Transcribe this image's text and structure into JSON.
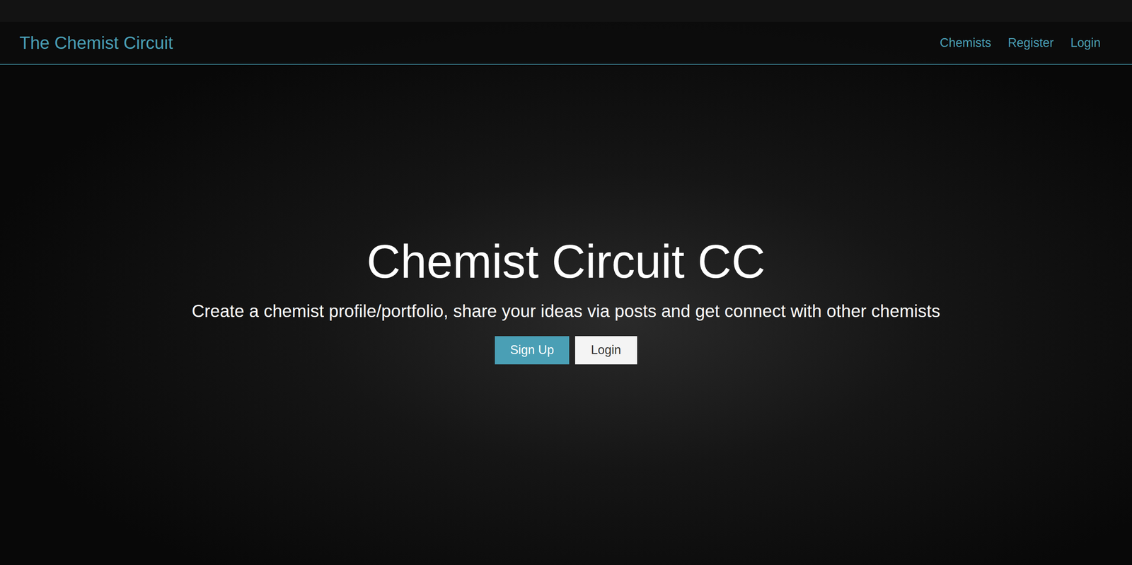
{
  "navbar": {
    "brand": "The Chemist Circuit",
    "links": [
      {
        "label": "Chemists"
      },
      {
        "label": "Register"
      },
      {
        "label": "Login"
      }
    ]
  },
  "hero": {
    "title": "Chemist Circuit CC",
    "subtitle": "Create a chemist profile/portfolio, share your ideas via posts and get connect with other chemists",
    "buttons": [
      {
        "label": "Sign Up",
        "kind": "primary"
      },
      {
        "label": "Login",
        "kind": "light"
      }
    ]
  }
}
